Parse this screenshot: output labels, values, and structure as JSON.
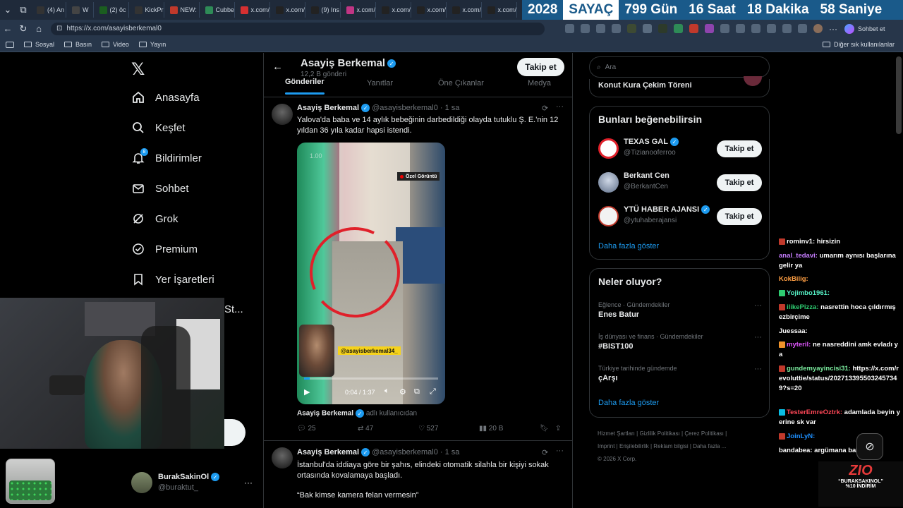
{
  "browser": {
    "tabs": [
      "(4) An",
      "W",
      "(2) öc",
      "KickPr",
      "NEW:",
      "Cubbe",
      "x.com/",
      "x.com/",
      "(9) Ins",
      "x.com/",
      "x.com/",
      "x.com/",
      "x.com/",
      "x.com/",
      "x.com/"
    ],
    "url": "https://x.com/asayisberkemal0",
    "bookmarks": [
      "Sosyal",
      "Basın",
      "Video",
      "Yayın"
    ],
    "other_bookmarks": "Diğer sık kullanılanlar",
    "chat_button": "Sohbet et"
  },
  "counter": {
    "year": "2028",
    "label": "SAYAÇ",
    "days": "799 Gün",
    "hours": "16 Saat",
    "minutes": "18 Dakika",
    "seconds": "58 Saniye"
  },
  "sidebar": {
    "items": [
      {
        "label": "Anasayfa",
        "icon": "home-icon"
      },
      {
        "label": "Keşfet",
        "icon": "search-icon"
      },
      {
        "label": "Bildirimler",
        "icon": "bell-icon",
        "badge": "8"
      },
      {
        "label": "Sohbet",
        "icon": "mail-icon"
      },
      {
        "label": "Grok",
        "icon": "grok-icon"
      },
      {
        "label": "Premium",
        "icon": "premium-icon"
      },
      {
        "label": "Yer İşaretleri",
        "icon": "bookmark-icon"
      }
    ],
    "truncated_item": "St...",
    "account": {
      "name": "BurakSakinOl",
      "handle": "@buraktut_"
    }
  },
  "profile": {
    "name": "Asayiş Berkemal",
    "posts_count": "12,2 B gönderi",
    "follow_label": "Takip et",
    "tabs": [
      "Gönderiler",
      "Yanıtlar",
      "Öne Çıkanlar",
      "Medya"
    ]
  },
  "posts": [
    {
      "name": "Asayiş Berkemal",
      "handle": "@asayisberkemal0",
      "time": "· 1 sa",
      "text": "Yalova'da baba ve 14 aylık bebeğinin darbedildiği olayda tutuklu Ş. E.'nin 12 yıldan 36 yıla kadar hapsi istendi.",
      "video": {
        "speed": "1.00",
        "badge": "Özel Görüntü",
        "watermark": "@asayisberkemal34_",
        "time": "0:04 / 1:37",
        "progress": 0.04
      },
      "attribution_name": "Asayiş Berkemal",
      "attribution_suffix": "adlı kullanıcıdan",
      "replies": "25",
      "reposts": "47",
      "likes": "527",
      "views": "20 B"
    },
    {
      "name": "Asayiş Berkemal",
      "handle": "@asayisberkemal0",
      "time": "· 1 sa",
      "text": "İstanbul'da iddiaya göre bir şahıs, elindeki otomatik silahla bir kişiyi sokak ortasında kovalamaya başladı.",
      "quote": "“Bak kimse kamera felan vermesin”"
    }
  ],
  "right": {
    "search_placeholder": "Ara",
    "event_title": "Konut Kura Çekim Töreni",
    "who_to_follow_title": "Bunları beğenebilirsin",
    "suggestions": [
      {
        "name": "TEXAS GAL",
        "handle": "@Tizianooferroo"
      },
      {
        "name": "Berkant Cen",
        "handle": "@BerkantCen"
      },
      {
        "name": "YTÜ HABER AJANSI",
        "handle": "@ytuhaberajansi"
      }
    ],
    "show_more": "Daha fazla göster",
    "trends_title": "Neler oluyor?",
    "trends": [
      {
        "category": "Eğlence · Gündemdekiler",
        "name": "Enes Batur"
      },
      {
        "category": "İş dünyası ve finans · Gündemdekiler",
        "name": "#BIST100"
      },
      {
        "category": "Türkiye tarihinde gündemde",
        "name": "çArşı"
      }
    ],
    "trends_show_more": "Daha fazla göster",
    "footer_links": [
      "Hizmet Şartları",
      "Gizlilik Politikası",
      "Çerez Politikası",
      "Imprint",
      "Erişilebilirlik",
      "Reklam bilgisi",
      "Daha fazla ..."
    ],
    "copyright": "© 2026 X Corp."
  },
  "chat": [
    {
      "user": "rominv1:",
      "msg": "hirsizin",
      "color": "#ffffff"
    },
    {
      "user": "anal_tedavi:",
      "msg": "umarım aynısı başlarına gelir ya",
      "color": "#c77dff"
    },
    {
      "user": "KokBilig:",
      "msg": "",
      "color": "#ff9f43"
    },
    {
      "user": "Yojimbo1961:",
      "msg": "",
      "color": "#55efc4"
    },
    {
      "user": "ilikePizza:",
      "msg": "nasrettin hoca çıldırmış ezbirçime",
      "color": "#2ecc71"
    },
    {
      "user": "Juessaa:",
      "msg": "",
      "color": "#ffffff"
    },
    {
      "user": "myteril:",
      "msg": "ne nasreddini amk evladı ya",
      "color": "#e056fd"
    },
    {
      "user": "gundemyayincisi31:",
      "msg": "https://x.com/revoluttie/status/2027133955032457349?s=20",
      "color": "#7bed9f"
    },
    {
      "user": "TesterEmreOztrk:",
      "msg": "adamlada beyin yerine sk var",
      "color": "#ff4757"
    },
    {
      "user": "JoinLyN:",
      "msg": "",
      "color": "#1e90ff"
    },
    {
      "user": "bandabea:",
      "msg": "argümana bak amk",
      "color": "#ffffff"
    }
  ],
  "promo": {
    "logo": "ZIO",
    "line1": "“BURAKSAKINOL”",
    "line2": "%10 İNDİRİM"
  }
}
